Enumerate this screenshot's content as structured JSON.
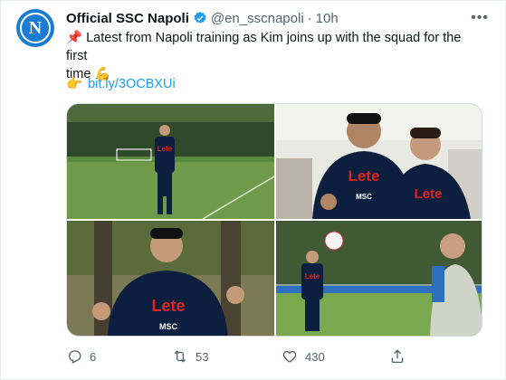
{
  "account": {
    "name": "Official SSC Napoli",
    "handle": "@en_sscnapoli",
    "separator": "·",
    "time": "10h",
    "avatar_letter": "N",
    "verified_color": "#1d9bf0"
  },
  "tweet": {
    "pin_emoji": "📌",
    "text_1": "Latest from Napoli training as Kim joins up with the squad for the first",
    "text_2": "time",
    "flex_emoji": "💪",
    "point_emoji": "👉",
    "link": "bit.ly/3OCBXUi"
  },
  "media": {
    "kit_sponsor": "Lete",
    "kit_sponsor_2": "MSC"
  },
  "actions": {
    "reply_icon": "reply-icon",
    "reply_count": "6",
    "retweet_icon": "retweet-icon",
    "retweet_count": "53",
    "like_icon": "heart-icon",
    "like_count": "430",
    "share_icon": "share-icon"
  },
  "colors": {
    "brand": "#1a7bd0",
    "link": "#1d9bf0",
    "kit": "#0d1f3f",
    "sponsor": "#e2231a"
  }
}
